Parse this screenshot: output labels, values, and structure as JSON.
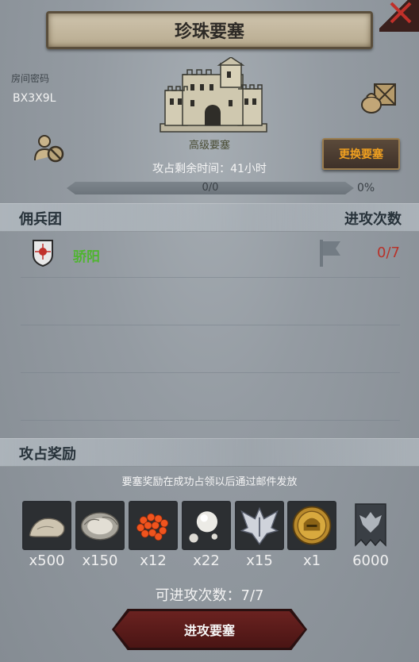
{
  "header": {
    "title": "珍珠要塞"
  },
  "room": {
    "label": "房间密码",
    "code": "BX3X9L"
  },
  "fortress": {
    "name": "高级要塞",
    "change_button": "更换要塞",
    "time_prefix": "攻占剩余时间：",
    "time_value": "41小时",
    "progress_text": "0/0",
    "progress_percent": "0%",
    "progress_fraction": 0
  },
  "mercenaries": {
    "section_title": "佣兵团",
    "attacks_header": "进攻次数",
    "rows": [
      {
        "name": "骄阳",
        "attacks": "0/7"
      }
    ]
  },
  "rewards": {
    "section_title": "攻占奖励",
    "note": "要塞奖励在成功占领以后通过邮件发放",
    "items": [
      {
        "icon": "stone-icon",
        "qty": "x500"
      },
      {
        "icon": "oyster-icon",
        "qty": "x150"
      },
      {
        "icon": "fish-roe-icon",
        "qty": "x12"
      },
      {
        "icon": "pearls-icon",
        "qty": "x22"
      },
      {
        "icon": "silver-wings-emblem-icon",
        "qty": "x15"
      },
      {
        "icon": "gold-helmet-coin-icon",
        "qty": "x1"
      },
      {
        "icon": "guild-banner-icon",
        "qty": "6000"
      }
    ]
  },
  "footer": {
    "attempts_label": "可进攻次数：",
    "attempts_value": "7/7",
    "attack_button": "进攻要塞"
  },
  "colors": {
    "accent_orange": "#f0a020",
    "green_name": "#4fb52f",
    "red_count": "#b8322a"
  }
}
